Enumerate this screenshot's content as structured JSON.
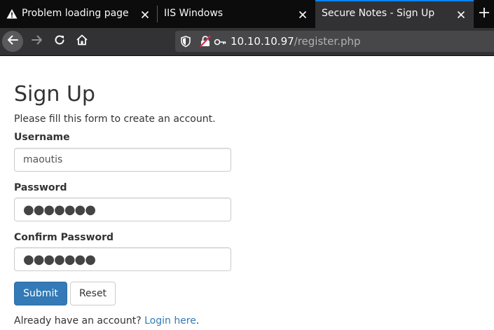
{
  "browser": {
    "tabs": [
      {
        "title": "Problem loading page",
        "icon": "warning-icon",
        "active": false
      },
      {
        "title": "IIS Windows",
        "icon": "none",
        "active": false
      },
      {
        "title": "Secure Notes - Sign Up",
        "icon": "none",
        "active": true
      }
    ],
    "url": {
      "host": "10.10.10.97",
      "path": "/register.php"
    },
    "colors": {
      "tabbar": "#0c0c0d",
      "toolbar": "#323234",
      "urlbar": "#474749",
      "active_accent": "#0a84ff"
    }
  },
  "page": {
    "title": "Sign Up",
    "intro": "Please fill this form to create an account.",
    "form": {
      "username_label": "Username",
      "username_value": "maoutis",
      "password_label": "Password",
      "password_value": "●●●●●●●",
      "confirm_label": "Confirm Password",
      "confirm_value": "●●●●●●●",
      "submit_label": "Submit",
      "reset_label": "Reset"
    },
    "footer": {
      "text": "Already have an account?",
      "link": "Login here",
      "end": "."
    },
    "colors": {
      "primary": "#337ab7",
      "link": "#337ab7",
      "text": "#333333"
    }
  }
}
